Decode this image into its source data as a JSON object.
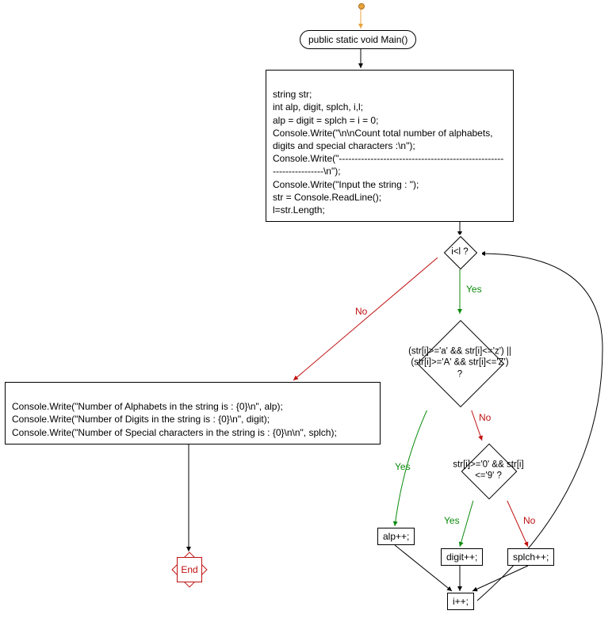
{
  "nodes": {
    "entry_label": "public static void Main()",
    "init_block": "string str;\nint alp, digit, splch, i,l;\nalp = digit = splch = i = 0;\nConsole.Write(\"\\n\\nCount total number of alphabets, digits and special characters :\\n\");\nConsole.Write(\"--------------------------------------------------------------------\\n\");\nConsole.Write(\"Input the string : \");\nstr = Console.ReadLine();\nl=str.Length;",
    "cond_loop": "i<l ?",
    "cond_alpha": "(str[i]>='a' && str[i]<='z') || (str[i]>='A' && str[i]<='Z') ?",
    "cond_digit": "str[i]>='0' && str[i]<='9' ?",
    "inc_alp": "alp++;",
    "inc_digit": "digit++;",
    "inc_splch": "splch++;",
    "inc_i": "i++;",
    "output_block": "Console.Write(\"Number of Alphabets in the string is : {0}\\n\", alp);\nConsole.Write(\"Number of Digits in the string is : {0}\\n\", digit);\nConsole.Write(\"Number of Special characters in the string is : {0}\\n\\n\", splch);",
    "end": "End"
  },
  "edges": {
    "yes": "Yes",
    "no": "No"
  }
}
